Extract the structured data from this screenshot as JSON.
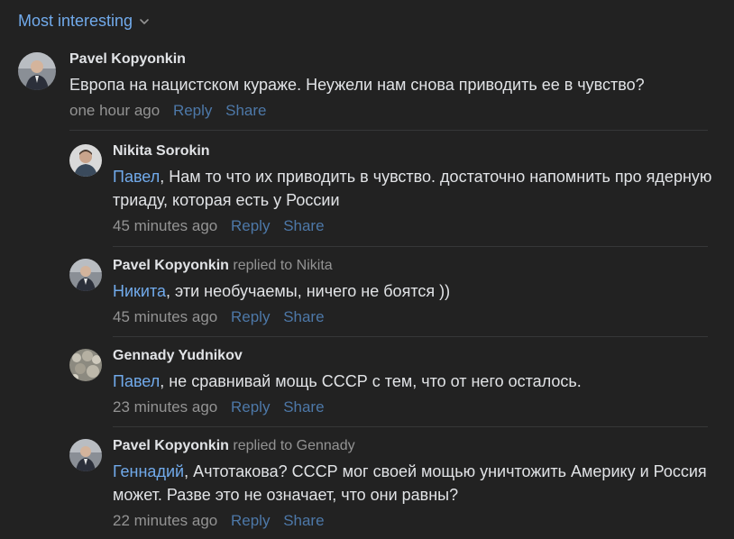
{
  "sort": {
    "label": "Most interesting"
  },
  "comments": [
    {
      "author": "Pavel Kopyonkin",
      "replied_prefix": "",
      "replied_to": "",
      "mention": "",
      "text": "Европа на нацистском кураже. Неужели нам снова приводить ее в чувство?",
      "time": "one hour ago",
      "reply": "Reply",
      "share": "Share"
    },
    {
      "author": "Nikita Sorokin",
      "replied_prefix": "",
      "replied_to": "",
      "mention": "Павел",
      "text": ", Нам то что их приводить в чувство. достаточно напомнить про ядерную триаду, которая есть у России",
      "time": "45 minutes ago",
      "reply": "Reply",
      "share": "Share"
    },
    {
      "author": "Pavel Kopyonkin",
      "replied_prefix": "replied to",
      "replied_to": "Nikita",
      "mention": "Никита",
      "text": ", эти необучаемы, ничего не боятся ))",
      "time": "45 minutes ago",
      "reply": "Reply",
      "share": "Share"
    },
    {
      "author": "Gennady Yudnikov",
      "replied_prefix": "",
      "replied_to": "",
      "mention": "Павел",
      "text": ", не сравнивай мощь СССР с тем, что от него осталось.",
      "time": "23 minutes ago",
      "reply": "Reply",
      "share": "Share"
    },
    {
      "author": "Pavel Kopyonkin",
      "replied_prefix": "replied to",
      "replied_to": "Gennady",
      "mention": "Геннадий",
      "text": ", Ачтотакова? СССР мог своей мощью уничтожить Америку и Россия может. Разве это не означает, что они равны?",
      "time": "22 minutes ago",
      "reply": "Reply",
      "share": "Share"
    }
  ],
  "colors": {
    "background": "#222222",
    "text": "#e1e3e6",
    "link": "#71aaeb",
    "muted": "#939393",
    "action": "#4d78a8"
  }
}
